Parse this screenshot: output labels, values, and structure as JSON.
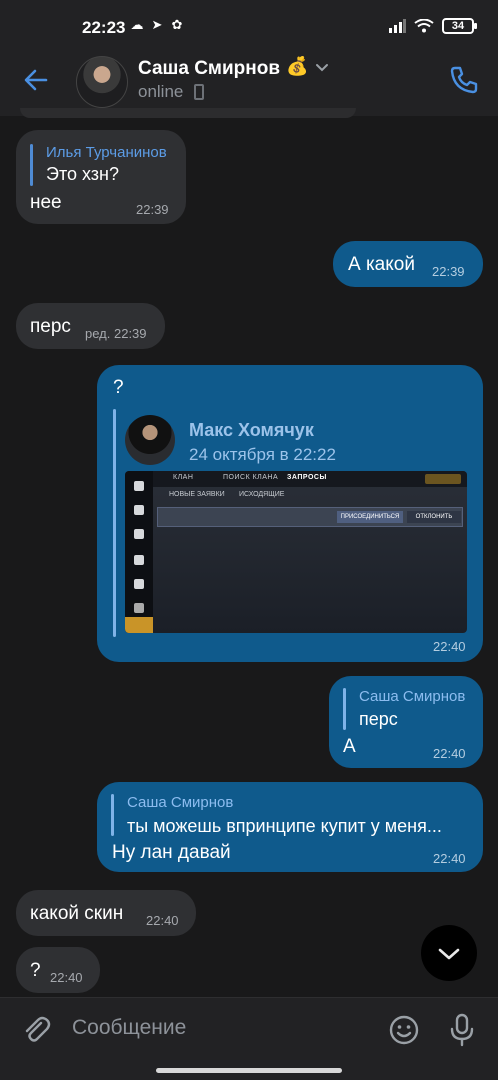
{
  "status_bar": {
    "time": "22:23",
    "battery": "34"
  },
  "header": {
    "name": "Саша Смирнов",
    "emoji": "💰",
    "status": "online"
  },
  "messages": [
    {
      "id": "m1",
      "dir": "in",
      "reply_name": "Илья Турчанинов",
      "reply_text": "Это хзн?",
      "text": "нее",
      "time": "22:39"
    },
    {
      "id": "m2",
      "dir": "out",
      "text": "А какой",
      "time": "22:39"
    },
    {
      "id": "m3",
      "dir": "in",
      "text": "перс",
      "time": "ред. 22:39"
    },
    {
      "id": "m4",
      "dir": "out",
      "text": "?",
      "forward": {
        "name": "Макс Хомячук",
        "date": "24 октября в 22:22"
      },
      "time": "22:40",
      "game": {
        "tabs": [
          "КЛАН",
          "ПОИСК КЛАНА",
          "ЗАПРОСЫ"
        ],
        "sub": [
          "НОВЫЕ ЗАЯВКИ",
          "ИСХОДЯЩИЕ"
        ],
        "buttons": [
          "ПРИСОЕДИНИТЬСЯ",
          "ОТКЛОНИТЬ"
        ]
      }
    },
    {
      "id": "m5",
      "dir": "out",
      "reply_name": "Саша Смирнов",
      "reply_text": "перс",
      "text": "А",
      "time": "22:40"
    },
    {
      "id": "m6",
      "dir": "out",
      "reply_name": "Саша Смирнов",
      "reply_text": "ты можешь впринципе купит у меня...",
      "text": "Ну лан давай",
      "time": "22:40"
    },
    {
      "id": "m7",
      "dir": "in",
      "text": "какой скин",
      "time": "22:40"
    },
    {
      "id": "m8",
      "dir": "in",
      "text": "?",
      "time": "22:40"
    }
  ],
  "composer": {
    "placeholder": "Сообщение"
  },
  "icons": [
    "back-arrow-icon",
    "chevron-down-icon",
    "phone-icon",
    "paperclip-icon",
    "emoji-icon",
    "microphone-icon",
    "scroll-down-icon"
  ],
  "colors": {
    "accent": "#4a90e2",
    "outgoing": "#0f5a8c",
    "incoming": "#2f3033",
    "background": "#19191a"
  }
}
